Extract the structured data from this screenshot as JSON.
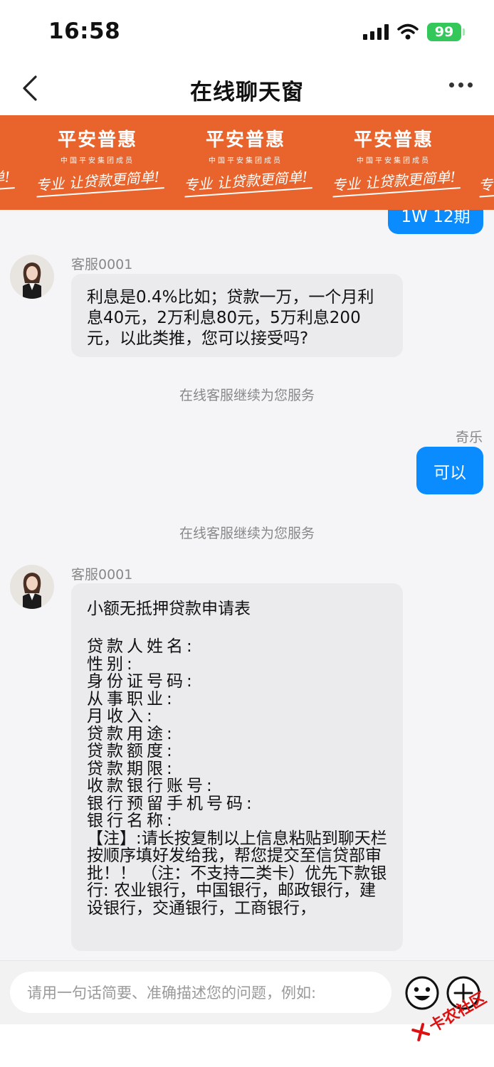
{
  "status_bar": {
    "time": "16:58",
    "battery": "99"
  },
  "nav": {
    "title": "在线聊天窗"
  },
  "banner": {
    "brand": "平安普惠",
    "subtitle": "中国平安集团成员",
    "slogan": "专业 让贷款更简单!"
  },
  "messages": {
    "top_partial": "1W 12期",
    "msg1": {
      "sender": "客服0001",
      "text": "利息是0.4%比如；贷款一万，一个月利息40元，2万利息80元，5万利息200元，以此类推，您可以接受吗?"
    },
    "system1": "在线客服继续为您服务",
    "user_name": "奇乐",
    "user_reply": "可以",
    "system2": "在线客服继续为您服务",
    "msg2": {
      "sender": "客服0001",
      "title": "小额无抵押贷款申请表",
      "fields": [
        "贷款人姓名:",
        "性别:",
        "身份证号码:",
        "从事职业:",
        "月收入:",
        "贷款用途:",
        "贷款额度:",
        "贷款期限:",
        "收款银行账号:",
        "银行预留手机号码:",
        "银行名称:"
      ],
      "note": "【注】:请长按复制以上信息粘贴到聊天栏按顺序填好发给我，帮您提交至信贷部审批！！ （注：不支持二类卡）优先下款银行: 农业银行，中国银行，邮政银行，建设银行，交通银行，工商银行，"
    }
  },
  "input": {
    "placeholder": "请用一句话简要、准确描述您的问题，例如:"
  },
  "watermark": {
    "text": "卡农社区"
  }
}
